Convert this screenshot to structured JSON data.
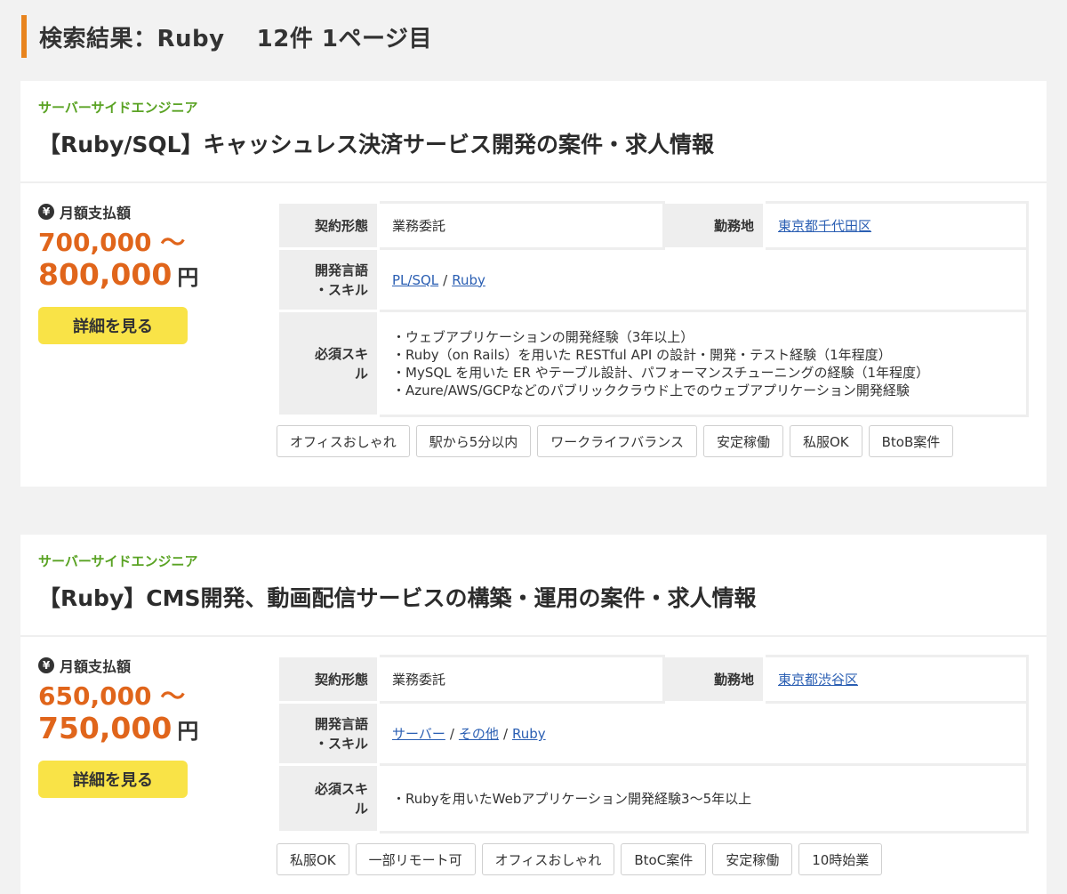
{
  "heading": {
    "text": "検索結果：Ruby　 12件 1ページ目"
  },
  "labels": {
    "price": "月額支払額",
    "unit": "円",
    "detail_button": "詳細を見る",
    "contract": "契約形態",
    "location": "勤務地",
    "lang": "開発言語・スキル",
    "required": "必須スキル"
  },
  "colors": {
    "accent": "#e8841e",
    "price": "#e0651b",
    "category": "#5aa324",
    "button": "#f9e347",
    "link": "#2b5fb3"
  },
  "jobs": [
    {
      "category": "サーバーサイドエンジニア",
      "title": "【Ruby/SQL】キャッシュレス決済サービス開発の案件・求人情報",
      "price_min": "700,000 〜",
      "price_max": "800,000",
      "contract": "業務委託",
      "location": "東京都千代田区",
      "skills": [
        "PL/SQL",
        "Ruby"
      ],
      "required": [
        "・ウェブアプリケーションの開発経験（3年以上）",
        "・Ruby（on Rails）を用いた RESTful API の設計・開発・テスト経験（1年程度）",
        "・MySQL を用いた ER やテーブル設計、パフォーマンスチューニングの経験（1年程度）",
        "・Azure/AWS/GCPなどのパブリッククラウド上でのウェブアプリケーション開発経験"
      ],
      "tags": [
        "オフィスおしゃれ",
        "駅から5分以内",
        "ワークライフバランス",
        "安定稼働",
        "私服OK",
        "BtoB案件"
      ]
    },
    {
      "category": "サーバーサイドエンジニア",
      "title": "【Ruby】CMS開発、動画配信サービスの構築・運用の案件・求人情報",
      "price_min": "650,000 〜",
      "price_max": "750,000",
      "contract": "業務委託",
      "location": "東京都渋谷区",
      "skills": [
        "サーバー",
        "その他",
        "Ruby"
      ],
      "required": [
        "・Rubyを用いたWebアプリケーション開発経験3〜5年以上"
      ],
      "tags": [
        "私服OK",
        "一部リモート可",
        "オフィスおしゃれ",
        "BtoC案件",
        "安定稼働",
        "10時始業"
      ]
    }
  ]
}
